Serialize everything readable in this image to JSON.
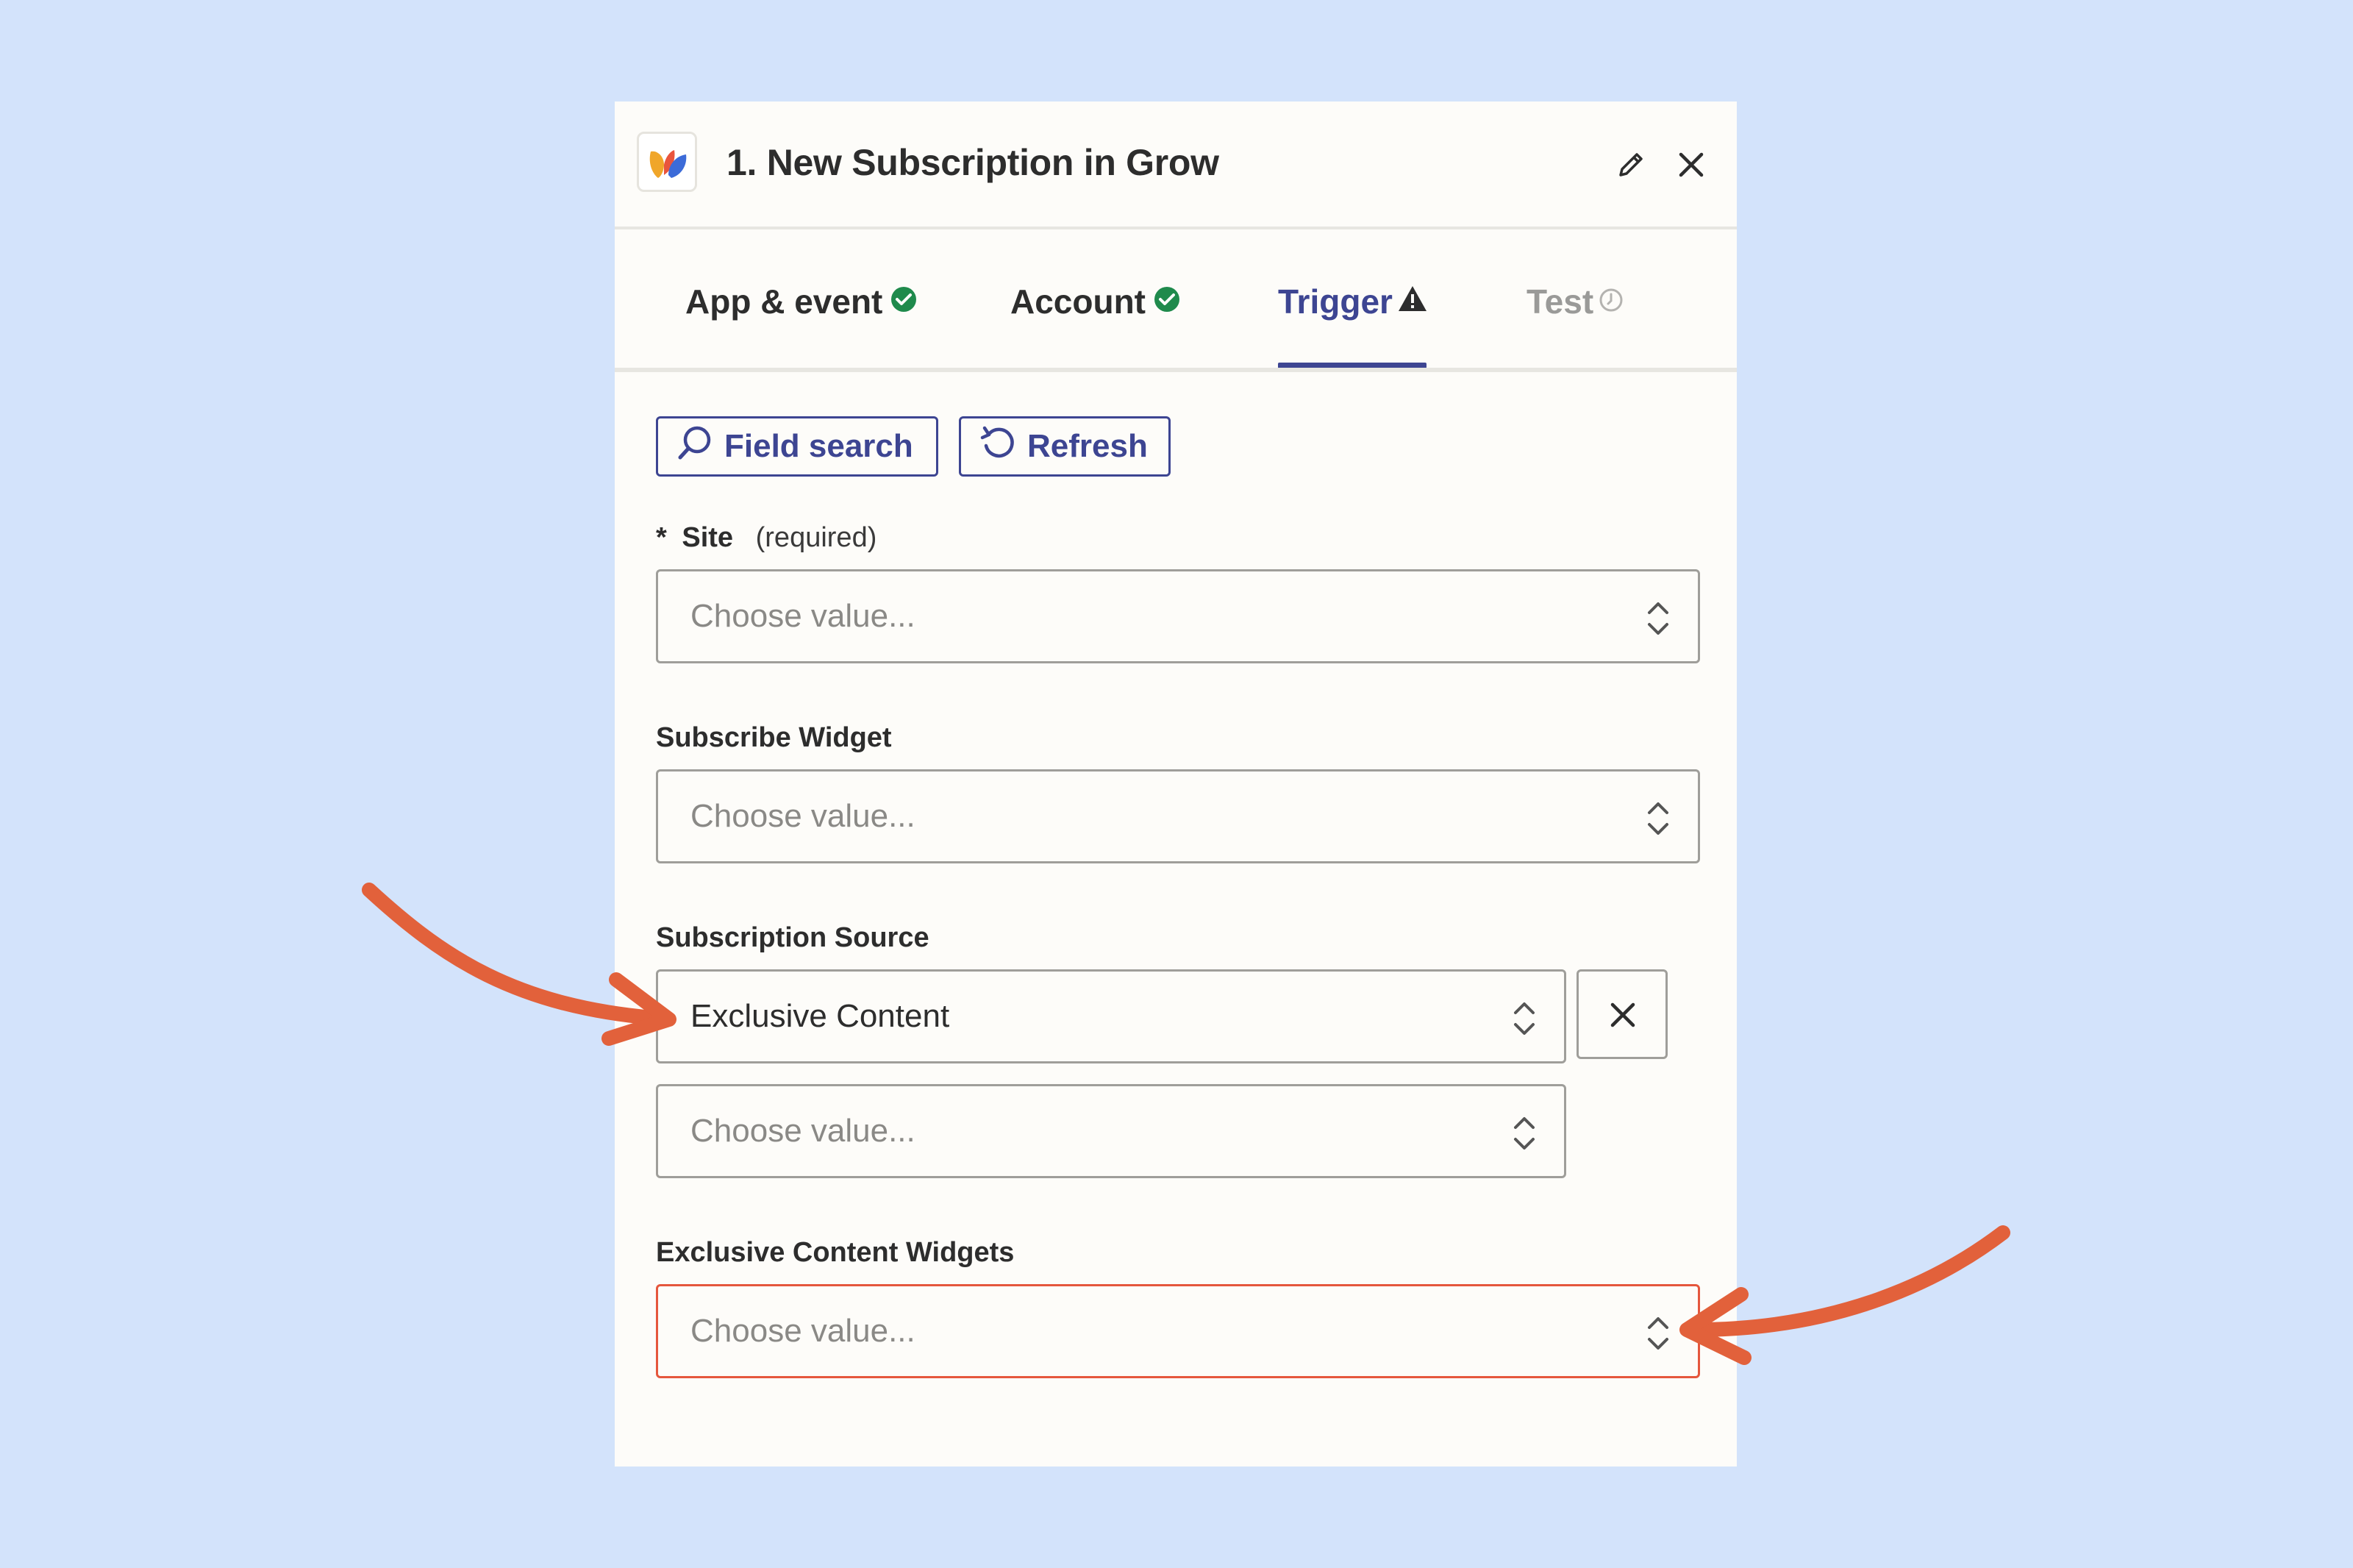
{
  "panel": {
    "title": "1. New Subscription in Grow",
    "icons": {
      "logo": "grow-app-logo",
      "edit": "pencil-icon",
      "close": "close-icon"
    }
  },
  "tabs": [
    {
      "label": "App & event",
      "status": "complete",
      "status_icon": "check-circle-icon"
    },
    {
      "label": "Account",
      "status": "complete",
      "status_icon": "check-circle-icon"
    },
    {
      "label": "Trigger",
      "status": "warning",
      "status_icon": "warning-triangle-icon",
      "active": true
    },
    {
      "label": "Test",
      "status": "pending",
      "status_icon": "clock-icon",
      "disabled": true
    }
  ],
  "toolbar": {
    "field_search_label": "Field search",
    "refresh_label": "Refresh"
  },
  "fields": {
    "site": {
      "asterisk": "*",
      "label": "Site",
      "required_note": "(required)",
      "placeholder": "Choose value..."
    },
    "subscribe_widget": {
      "label": "Subscribe Widget",
      "placeholder": "Choose value..."
    },
    "subscription_source": {
      "label": "Subscription Source",
      "value": "Exclusive Content",
      "additional_placeholder": "Choose value..."
    },
    "exclusive_content_widgets": {
      "label": "Exclusive Content Widgets",
      "placeholder": "Choose value...",
      "state": "error"
    }
  },
  "colors": {
    "background": "#d3e3fb",
    "accent": "#3d4592",
    "success": "#1f8a4c",
    "error": "#e5573d",
    "annotation_arrow": "#e2613b"
  }
}
